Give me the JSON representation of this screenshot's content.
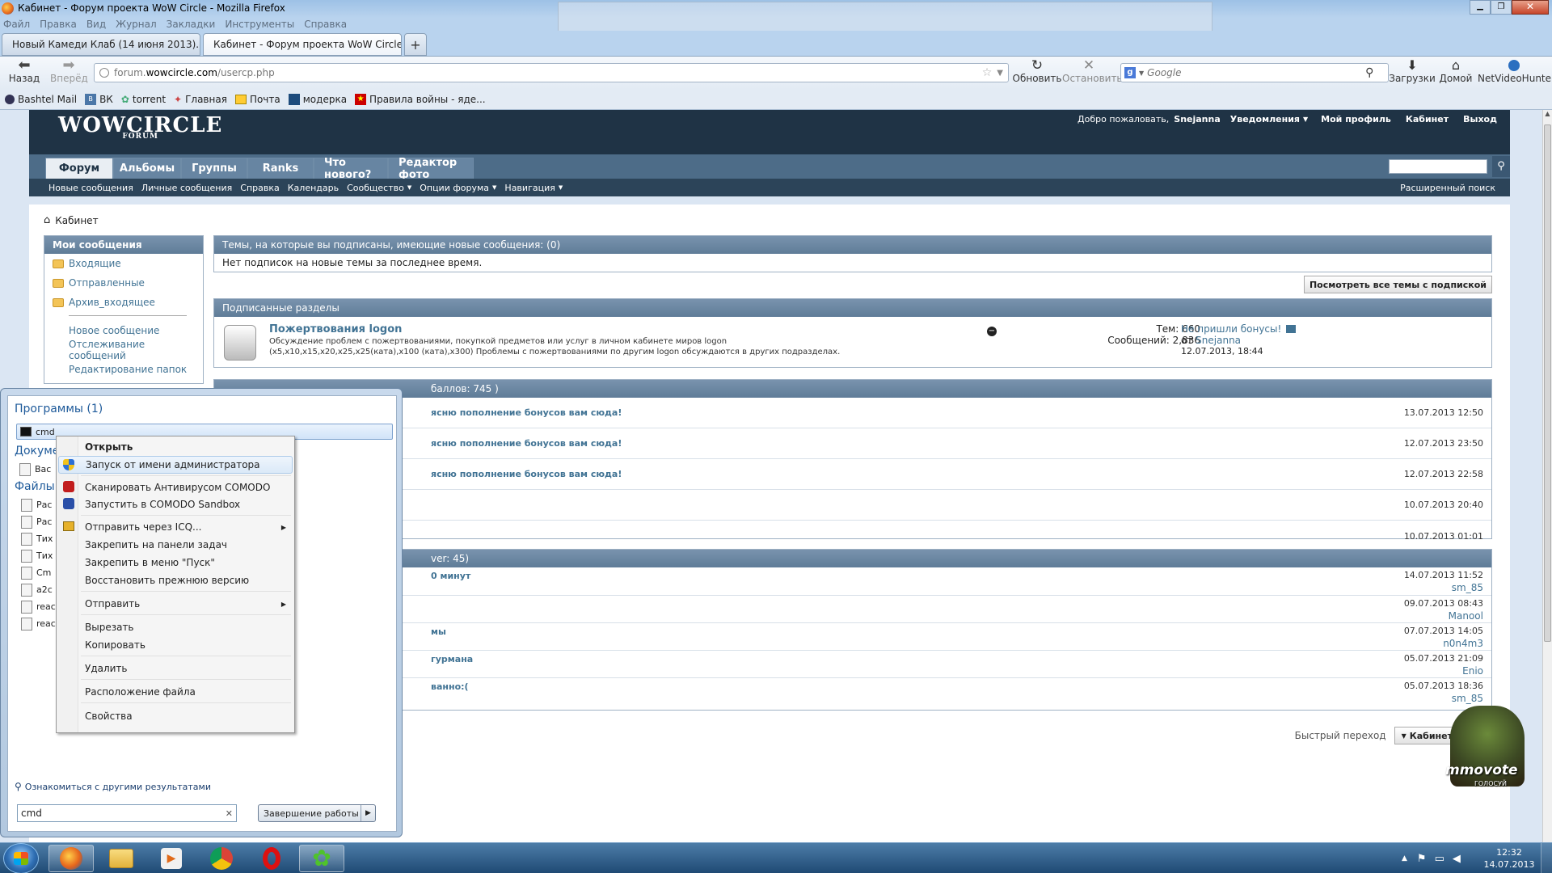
{
  "window": {
    "title": "Кабинет - Форум проекта WoW Circle - Mozilla Firefox",
    "controls": [
      "minimize",
      "maximize",
      "close"
    ]
  },
  "menubar": [
    "Файл",
    "Правка",
    "Вид",
    "Журнал",
    "Закладки",
    "Инструменты",
    "Справка"
  ],
  "tabs": [
    {
      "label": "Новый Камеди Клаб (14 июня 2013)....",
      "active": false
    },
    {
      "label": "Кабинет - Форум проекта WoW Circle",
      "active": true
    }
  ],
  "navbar": {
    "back": "Назад",
    "forward": "Вперёд",
    "url_host": "forum.",
    "url_domain": "wowcircle.com",
    "url_path": "/usercp.php",
    "reload": "Обновить",
    "stop": "Остановить",
    "search_placeholder": "Google",
    "downloads": "Загрузки",
    "home": "Домой",
    "netvideohunter": "NetVideoHunter"
  },
  "bookmarks": [
    "Bashtel Mail",
    "ВК",
    "torrent",
    "Главная",
    "Почта",
    "модерка",
    "Правила войны - яде..."
  ],
  "forum": {
    "logo": "WOWCIRCLE",
    "logo_sub": "FORUM",
    "welcome": "Добро пожаловать,",
    "username": "Snejanna",
    "notifications": "Уведомления",
    "my_profile": "Мой профиль",
    "cabinet": "Кабинет",
    "logout": "Выход",
    "nav_tabs": [
      "Форум",
      "Альбомы",
      "Группы",
      "Ranks",
      "Что нового?",
      "Редактор фото"
    ],
    "subnav": [
      "Новые сообщения",
      "Личные сообщения",
      "Справка",
      "Календарь",
      "Сообщество",
      "Опции форума",
      "Навигация"
    ],
    "advanced_search": "Расширенный поиск",
    "breadcrumb": "Кабинет",
    "sidebar": {
      "title": "Мои сообщения",
      "folders": [
        "Входящие",
        "Отправленные",
        "Архив_входящее"
      ],
      "links": [
        "Новое сообщение",
        "Отслеживание сообщений",
        "Редактирование папок"
      ]
    },
    "subscribed_threads": {
      "title": "Темы, на которые вы подписаны, имеющие новые сообщения: (0)",
      "empty": "Нет подписок на новые темы за последнее время.",
      "button": "Посмотреть все темы с подпиской"
    },
    "subscribed_forums": {
      "title": "Подписанные разделы",
      "forum_name": "Пожертвования logon",
      "forum_desc": "Обсуждение проблем с пожертвованиями, покупкой предметов или услуг в личном кабинете миров logon (x5,x10,x15,x20,x25,x25(ката),x100 (ката),x300) Проблемы с пожертвованиями по другим logon обсуждаются в других подразделах.",
      "threads": "Тем: 660",
      "posts": "Сообщений: 2,836",
      "last_title": "Не пришли бонусы!",
      "last_from": "от",
      "last_user": "Snejanna",
      "last_date": "12.07.2013, 18:44"
    },
    "block3": {
      "title_tail": "баллов: 745 )",
      "rows": [
        {
          "text": "ясню пополнение бонусов вам сюда!",
          "date": "13.07.2013 12:50"
        },
        {
          "text": "ясню пополнение бонусов вам сюда!",
          "date": "12.07.2013 23:50"
        },
        {
          "text": "ясню пополнение бонусов вам сюда!",
          "date": "12.07.2013 22:58"
        },
        {
          "text": "",
          "date": "10.07.2013 20:40"
        },
        {
          "text": "",
          "date": "10.07.2013 01:01"
        }
      ]
    },
    "block4": {
      "title_tail": "ver: 45)",
      "rows": [
        {
          "text": "0 минут",
          "date": "14.07.2013 11:52",
          "user": "sm_85"
        },
        {
          "text": "",
          "date": "09.07.2013 08:43",
          "user": "Manool"
        },
        {
          "text": "мы",
          "date": "07.07.2013 14:05",
          "user": "n0n4m3"
        },
        {
          "text": "гурмана",
          "date": "05.07.2013 21:09",
          "user": "Enio"
        },
        {
          "text": "ванно:(",
          "date": "05.07.2013 18:36",
          "user": "sm_85"
        }
      ]
    },
    "quick_nav_label": "Быстрый переход",
    "quick_nav_value": "Кабинет",
    "vote_text": "mmovote",
    "vote_sub": "ГОЛОСУЙ"
  },
  "startmenu": {
    "programs_title": "Программы (1)",
    "program_item": "cmd",
    "documents_title": "Докуме",
    "document_item": "Вас",
    "files_title": "Файлы",
    "files": [
      "Рас",
      "Рас",
      "Тих",
      "Тих",
      "Cm",
      "a2c",
      "reac",
      "reac"
    ],
    "see_more": "Ознакомиться с другими результатами",
    "search_value": "cmd",
    "shutdown": "Завершение работы"
  },
  "context_menu": {
    "items": [
      {
        "label": "Открыть",
        "bold": true,
        "highlight": false,
        "icon": "",
        "submenu": false
      },
      {
        "label": "Запуск от имени администратора",
        "bold": false,
        "highlight": true,
        "icon": "shield-icon",
        "submenu": false
      },
      {
        "label": "Сканировать Антивирусом COMODO",
        "bold": false,
        "highlight": false,
        "icon": "comodo-icon",
        "submenu": false
      },
      {
        "label": "Запустить в COMODO Sandbox",
        "bold": false,
        "highlight": false,
        "icon": "sandbox-icon",
        "submenu": false
      },
      {
        "label": "Отправить через ICQ...",
        "bold": false,
        "highlight": false,
        "icon": "icq-icon",
        "submenu": true
      },
      {
        "label": "Закрепить на панели задач",
        "bold": false,
        "highlight": false,
        "icon": "",
        "submenu": false
      },
      {
        "label": "Закрепить в меню \"Пуск\"",
        "bold": false,
        "highlight": false,
        "icon": "",
        "submenu": false
      },
      {
        "label": "Восстановить прежнюю версию",
        "bold": false,
        "highlight": false,
        "icon": "",
        "submenu": false
      },
      {
        "label": "Отправить",
        "bold": false,
        "highlight": false,
        "icon": "",
        "submenu": true
      },
      {
        "label": "Вырезать",
        "bold": false,
        "highlight": false,
        "icon": "",
        "submenu": false
      },
      {
        "label": "Копировать",
        "bold": false,
        "highlight": false,
        "icon": "",
        "submenu": false
      },
      {
        "label": "Удалить",
        "bold": false,
        "highlight": false,
        "icon": "",
        "submenu": false
      },
      {
        "label": "Расположение файла",
        "bold": false,
        "highlight": false,
        "icon": "",
        "submenu": false
      },
      {
        "label": "Свойства",
        "bold": false,
        "highlight": false,
        "icon": "",
        "submenu": false
      }
    ]
  },
  "taskbar": {
    "time": "12:32",
    "date": "14.07.2013",
    "apps": [
      "firefox",
      "explorer",
      "media-player",
      "chrome",
      "opera",
      "icq"
    ]
  },
  "colors": {
    "forum_header": "#1f3345",
    "forum_nav": "#4d6c88",
    "link": "#417394",
    "taskbar": "#1f4a74"
  }
}
